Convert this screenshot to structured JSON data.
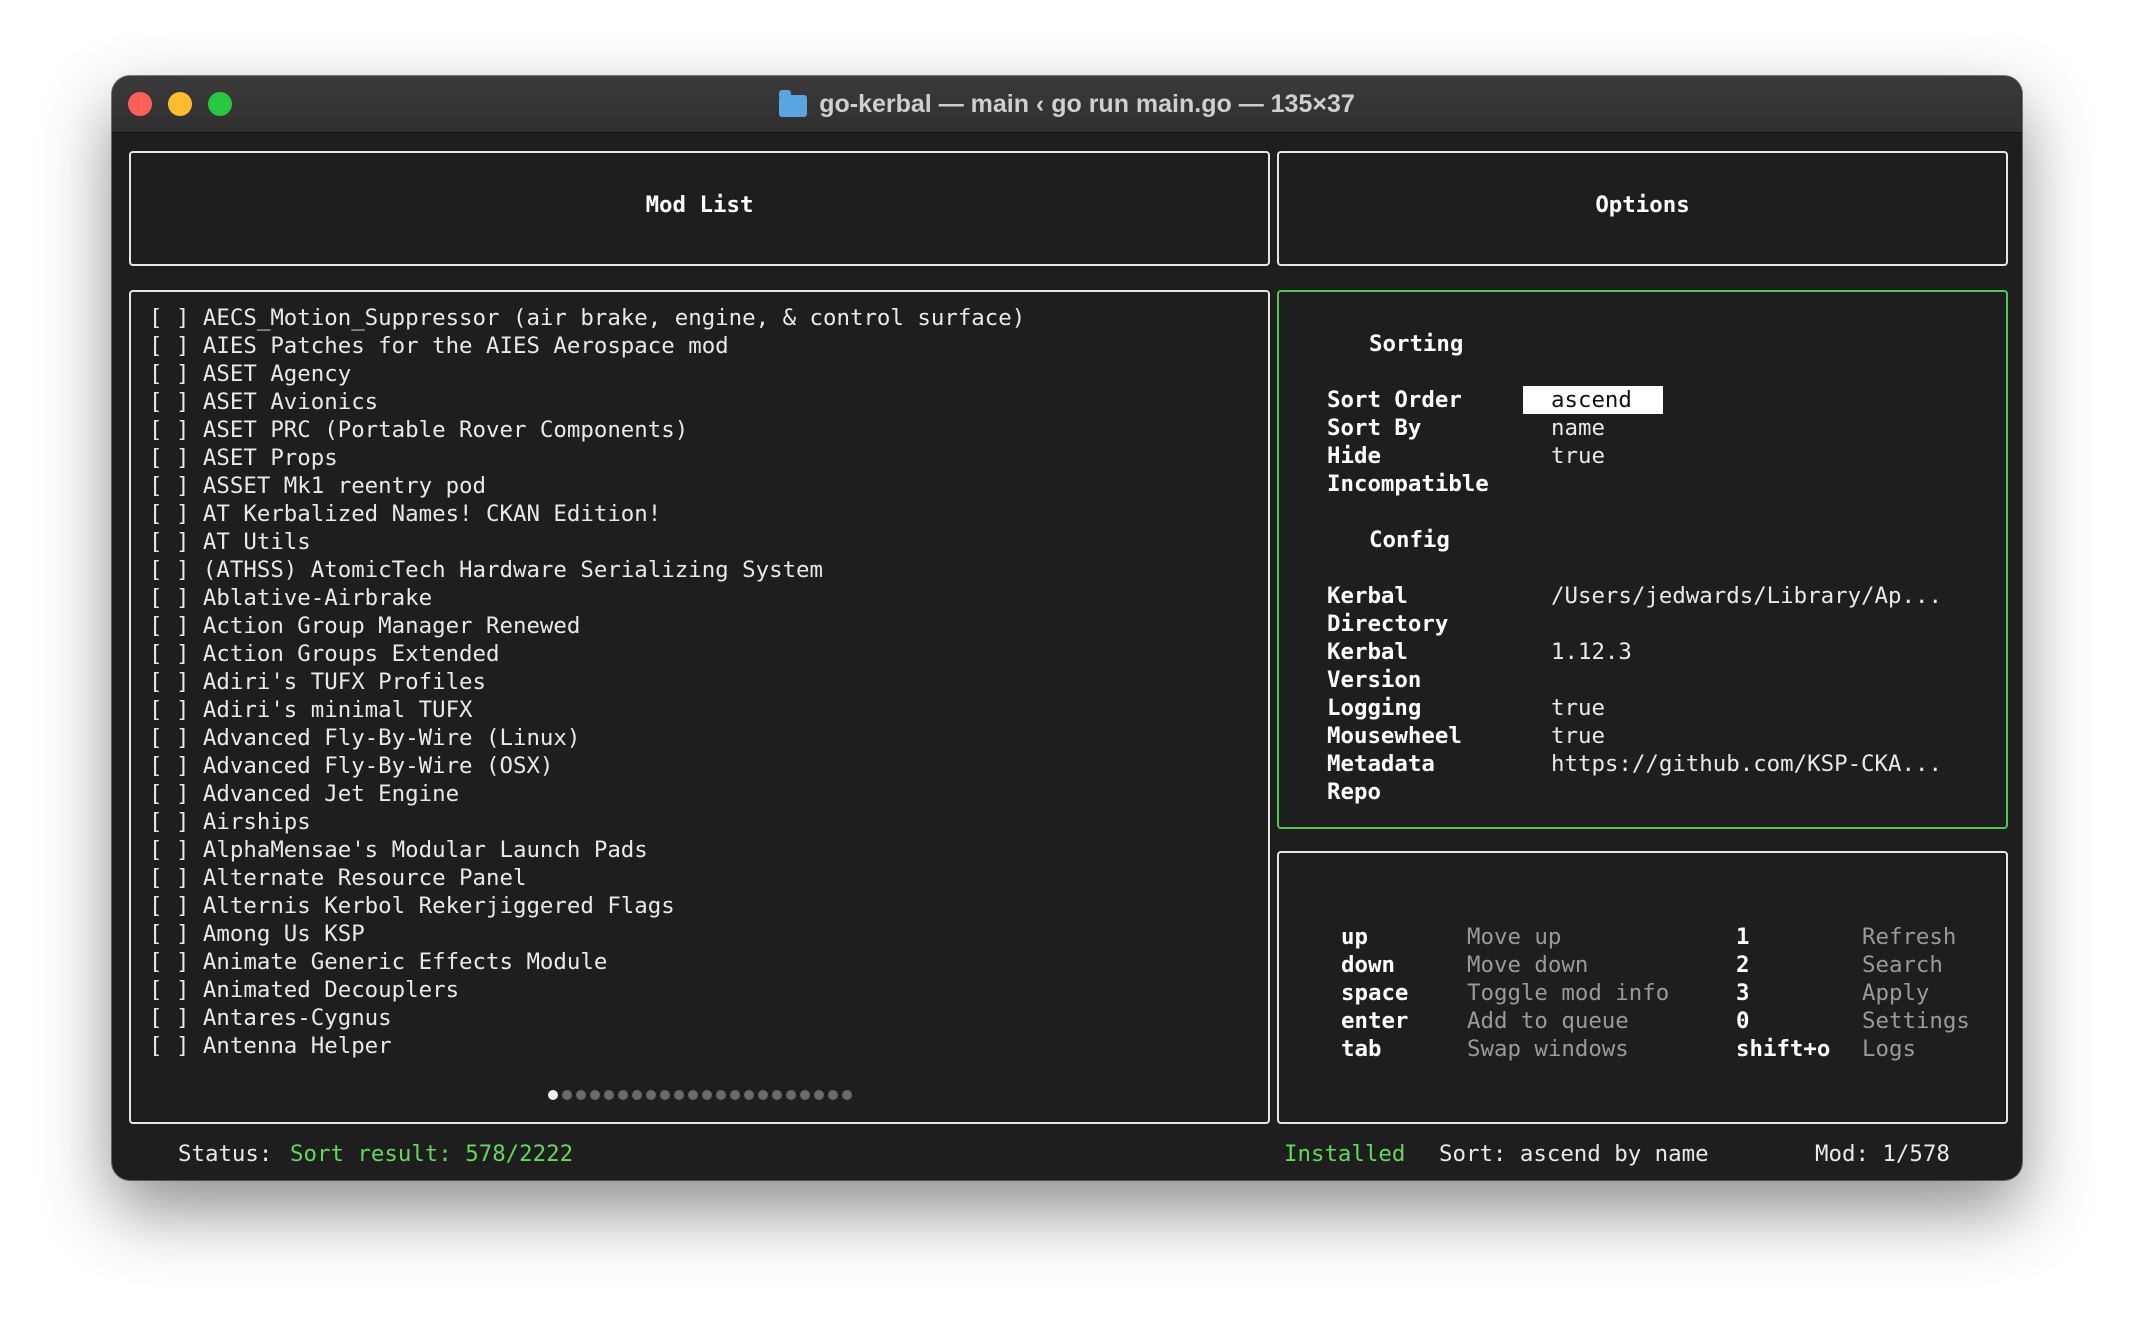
{
  "window": {
    "title": "go-kerbal — main ‹ go run main.go — 135×37"
  },
  "mod_list_panel": {
    "title": "Mod List",
    "items": [
      "[ ] AECS_Motion_Suppressor (air brake, engine, & control surface)",
      "[ ] AIES Patches for the AIES Aerospace mod",
      "[ ] ASET Agency",
      "[ ] ASET Avionics",
      "[ ] ASET PRC (Portable Rover Components)",
      "[ ] ASET Props",
      "[ ] ASSET Mk1 reentry pod",
      "[ ] AT Kerbalized Names! CKAN Edition!",
      "[ ] AT Utils",
      "[ ] (ATHSS) AtomicTech Hardware Serializing System",
      "[ ] Ablative-Airbrake",
      "[ ] Action Group Manager Renewed",
      "[ ] Action Groups Extended",
      "[ ] Adiri's TUFX Profiles",
      "[ ] Adiri's minimal TUFX",
      "[ ] Advanced Fly-By-Wire (Linux)",
      "[ ] Advanced Fly-By-Wire (OSX)",
      "[ ] Advanced Jet Engine",
      "[ ] Airships",
      "[ ] AlphaMensae's Modular Launch Pads",
      "[ ] Alternate Resource Panel",
      "[ ] Alternis Kerbol Rekerjiggered Flags",
      "[ ] Among Us KSP",
      "[ ] Animate Generic Effects Module",
      "[ ] Animated Decouplers",
      "[ ] Antares-Cygnus",
      "[ ] Antenna Helper"
    ],
    "page_count": 22,
    "current_page": 1
  },
  "options_panel": {
    "title": "Options",
    "sorting_heading": "Sorting",
    "sort_order_label": "Sort Order",
    "sort_order_value": "ascend",
    "sort_by_label": "Sort By",
    "sort_by_value": "name",
    "hide_incompatible_label_1": "Hide",
    "hide_incompatible_label_2": "Incompatible",
    "hide_incompatible_value": "true",
    "config_heading": "Config",
    "kerbal_directory_label_1": "Kerbal",
    "kerbal_directory_label_2": "Directory",
    "kerbal_directory_value": "/Users/jedwards/Library/Ap...",
    "kerbal_version_label_1": "Kerbal",
    "kerbal_version_label_2": "Version",
    "kerbal_version_value": "1.12.3",
    "logging_label": "Logging",
    "logging_value": "true",
    "mousewheel_label": "Mousewheel",
    "mousewheel_value": "true",
    "metadata_repo_label_1": "Metadata",
    "metadata_repo_label_2": "Repo",
    "metadata_repo_value": "https://github.com/KSP-CKA..."
  },
  "help_panel": {
    "left": [
      {
        "key": "up",
        "desc": "Move up"
      },
      {
        "key": "down",
        "desc": "Move down"
      },
      {
        "key": "space",
        "desc": "Toggle mod info"
      },
      {
        "key": "enter",
        "desc": "Add to queue"
      },
      {
        "key": "tab",
        "desc": "Swap windows"
      }
    ],
    "right": [
      {
        "key": "1",
        "desc": "Refresh"
      },
      {
        "key": "2",
        "desc": "Search"
      },
      {
        "key": "3",
        "desc": "Apply"
      },
      {
        "key": "0",
        "desc": "Settings"
      },
      {
        "key": "shift+o",
        "desc": "Logs"
      }
    ]
  },
  "status_bar": {
    "status_label": "Status:",
    "status_value": "Sort result: 578/2222",
    "view_mode": "Installed",
    "sort_info": "Sort: ascend by name",
    "mod_position": "Mod: 1/578"
  },
  "colors": {
    "active_border": "#4fc94f",
    "status_green": "#62d95a",
    "background": "#1e1e1e"
  }
}
